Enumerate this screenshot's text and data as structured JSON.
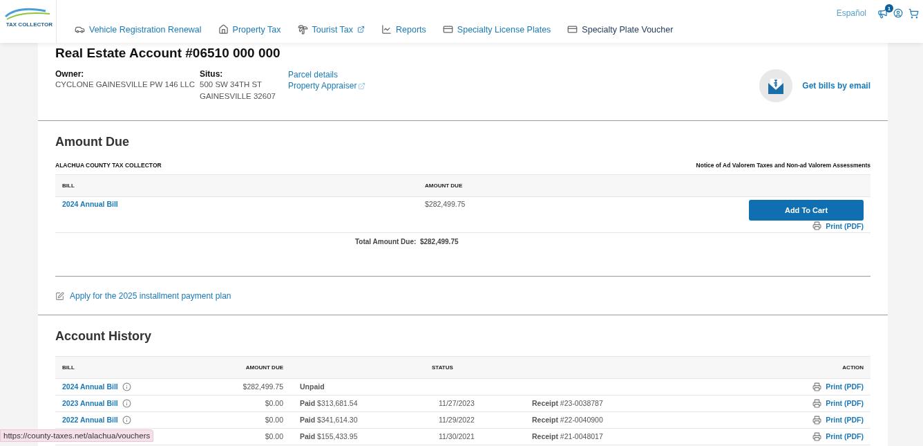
{
  "logo": {
    "text": "TAX COLLECTOR"
  },
  "nav": [
    {
      "label": "Vehicle Registration Renewal",
      "kind": "car",
      "external": false,
      "selected": false
    },
    {
      "label": "Property Tax",
      "kind": "home",
      "external": false,
      "selected": false
    },
    {
      "label": "Tourist Tax",
      "kind": "palm",
      "external": true,
      "selected": false
    },
    {
      "label": "Reports",
      "kind": "chart",
      "external": false,
      "selected": false
    },
    {
      "label": "Specialty License Plates",
      "kind": "plate",
      "external": false,
      "selected": false
    },
    {
      "label": "Specialty Plate Voucher",
      "kind": "plate",
      "external": false,
      "selected": true
    }
  ],
  "header_tools": {
    "language": "Español",
    "notifications": "1"
  },
  "account": {
    "title": "Real Estate Account #06510 000 000",
    "owner_label": "Owner:",
    "owner": "CYCLONE GAINESVILLE PW 146 LLC",
    "situs_label": "Situs:",
    "situs": [
      "500 SW 34TH ST",
      "GAINESVILLE 32607"
    ],
    "links": [
      {
        "label": "Parcel details",
        "external": false
      },
      {
        "label": "Property Appraiser",
        "external": true
      }
    ],
    "email_link": "Get bills by email"
  },
  "amount_due": {
    "title": "Amount Due",
    "agency": "ALACHUA COUNTY TAX COLLECTOR",
    "notice": "Notice of Ad Valorem Taxes and Non-ad Valorem Assessments",
    "columns": [
      "BILL",
      "AMOUNT DUE"
    ],
    "rows": [
      {
        "bill": "2024 Annual Bill",
        "amount": "$282,499.75",
        "button": "Add To Cart",
        "print": "Print (PDF)"
      }
    ],
    "total_label": "Total Amount Due:",
    "total": "$282,499.75",
    "installment_link": "Apply for the 2025 installment payment plan"
  },
  "history": {
    "title": "Account History",
    "columns": [
      "BILL",
      "AMOUNT DUE",
      "STATUS",
      "ACTION"
    ],
    "rows": [
      {
        "bill": "2024 Annual Bill",
        "amount": "$282,499.75",
        "status": "Unpaid",
        "print": "Print (PDF)"
      },
      {
        "bill": "2023 Annual Bill",
        "amount": "$0.00",
        "status": "Paid",
        "paid_amount": "$313,681.54",
        "date": "11/27/2023",
        "receipt_label": "Receipt",
        "receipt": "#23-0038787",
        "print": "Print (PDF)"
      },
      {
        "bill": "2022 Annual Bill",
        "amount": "$0.00",
        "status": "Paid",
        "paid_amount": "$341,614.30",
        "date": "11/29/2022",
        "receipt_label": "Receipt",
        "receipt": "#22-0040900",
        "print": "Print (PDF)"
      },
      {
        "amount": "$0.00",
        "status": "Paid",
        "paid_amount": "$155,433.95",
        "date": "11/30/2021",
        "receipt_label": "Receipt",
        "receipt": "#21-0048017",
        "print": "Print (PDF)"
      }
    ]
  },
  "status_url": "https://county-taxes.net/alachua/vouchers"
}
